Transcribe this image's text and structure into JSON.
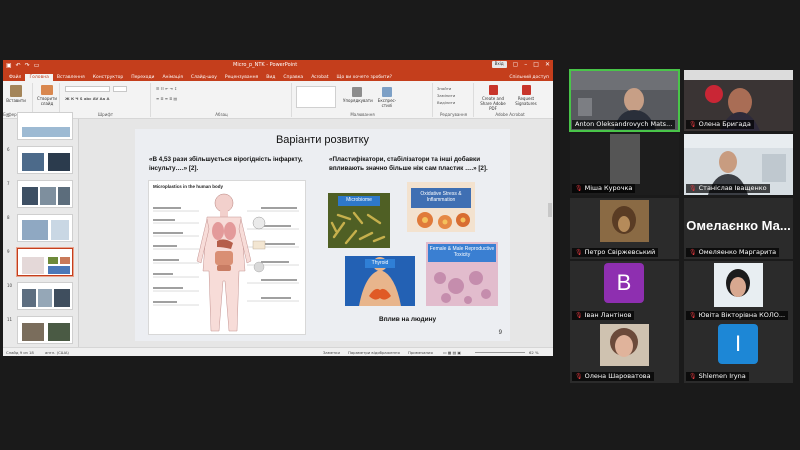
{
  "ppt": {
    "doc_title": "Micro_p_NTK  -  PowerPoint",
    "user_chip": "Вхід",
    "menu_tabs": [
      "Файл",
      "Головна",
      "Вставлення",
      "Конструктор",
      "Переходи",
      "Анімація",
      "Слайд-шоу",
      "Рецензування",
      "Вид",
      "Справка",
      "Acrobat",
      "Що ви хочете зробити?"
    ],
    "share_label": "Спільний доступ",
    "ribbon": {
      "paste": "Вставити",
      "new_slide": "Створити слайд",
      "clipboard_group": "Буфер обміну",
      "slides_group": "Слайди",
      "font_group": "Шрифт",
      "paragraph_group": "Абзац",
      "drawing_group": "Малювання",
      "editing_group": "Редагування",
      "arrange": "Упорядкувати",
      "quick_styles": "Експрес-стилі",
      "find": "Знайти",
      "replace": "Замінити",
      "select": "Виділити",
      "adobe_create": "Create and Share Adobe PDF",
      "adobe_request": "Request Signatures",
      "adobe_group": "Adobe Acrobat"
    },
    "slide_numbers": [
      "5",
      "6",
      "7",
      "8",
      "9",
      "10",
      "11"
    ],
    "slide": {
      "title": "Варіанти розвитку",
      "quote_left": "«В 4,53 рази збільшується вірогідність інфаркту, інсульту….» [2].",
      "quote_right": "«Пластифікатори, стабілізатори та інші добавки впливають значно більше ніж сам пластик ….» [2].",
      "figure_title": "Microplastics in the human body",
      "box_microbiome": "Microbiome",
      "box_oxidative": "Oxidative Stress & Inflammation",
      "box_thyroid": "Thyroid",
      "box_reproductive": "Female & Male Reproductive Toxicity",
      "impact": "Вплив на людину",
      "page": "9"
    },
    "status": {
      "slide_pos": "Слайд 9 из 18",
      "lang": "англ. (США)",
      "notes": "Заметки",
      "comments": "Параметри відображення",
      "view": "Примечания",
      "zoom": "62 %"
    }
  },
  "participants": [
    {
      "name": "Anton Oleksandrovych Mats...",
      "muted": false,
      "active": true
    },
    {
      "name": "Олена Бригада",
      "muted": true
    },
    {
      "name": "Міша Курочка",
      "muted": true
    },
    {
      "name": "Станіслав Іващенко",
      "muted": true
    },
    {
      "name": "Петро Свіржевський",
      "muted": true
    },
    {
      "name": "Омеляенко Маргарита",
      "muted": true,
      "big_name": "Омелаєнко  Ма..."
    },
    {
      "name": "Іван Лантінов",
      "muted": true,
      "initial": "B"
    },
    {
      "name": "Ювіта Вікторівна КОЛО...",
      "muted": true
    },
    {
      "name": "Олена Шароватова",
      "muted": true
    },
    {
      "name": "Shlemen Iryna",
      "muted": true,
      "initial": "I"
    }
  ],
  "colors": {
    "ppt_accent": "#c43e1c",
    "active_speaker": "#49c549",
    "muted_icon": "#e0383e",
    "avatar_purple": "#8e2fb0",
    "avatar_blue": "#1d87d6"
  }
}
